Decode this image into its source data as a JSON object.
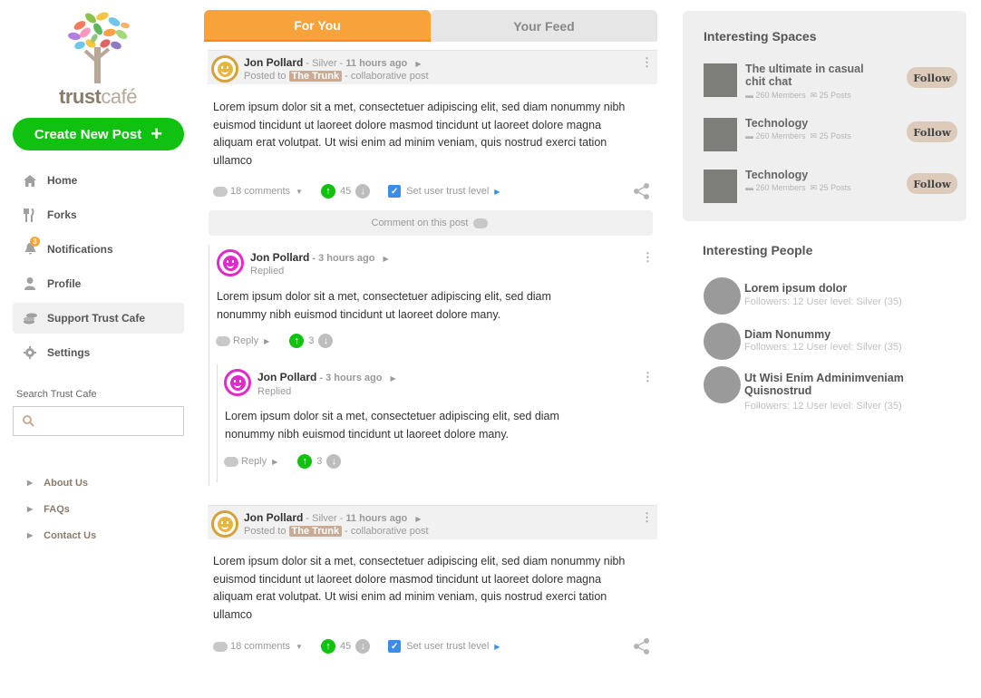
{
  "brand": {
    "name_main": "trust",
    "name_accent": "café"
  },
  "sidebar": {
    "create_button": "Create New Post",
    "nav": [
      {
        "label": "Home",
        "icon": "home-icon"
      },
      {
        "label": "Forks",
        "icon": "forks-icon"
      },
      {
        "label": "Notifications",
        "icon": "bell-icon",
        "badge": "3"
      },
      {
        "label": "Profile",
        "icon": "user-icon"
      },
      {
        "label": "Support Trust Cafe",
        "icon": "coins-icon"
      },
      {
        "label": "Settings",
        "icon": "gear-icon"
      }
    ],
    "search_label": "Search Trust Cafe",
    "search_placeholder": "",
    "footer_links": [
      "About Us",
      "FAQs",
      "Contact Us"
    ]
  },
  "tabs": {
    "for_you": "For You",
    "your_feed": "Your Feed"
  },
  "posts": [
    {
      "author": "Jon Pollard",
      "rank": "- Silver -",
      "time": "11 hours ago",
      "posted_to_prefix": "Posted to",
      "space_tag": "The Trunk",
      "posted_to_suffix": "- collaborative post",
      "body": "Lorem ipsum dolor sit a met, consectetuer adipiscing elit, sed diam nonummy nibh euismod tincidunt ut laoreet dolore masmod tincidunt ut laoreet dolore magna aliquam erat volutpat. Ut wisi enim ad minim veniam, quis nostrud exerci tation ullamco",
      "comments": "18 comments",
      "votes": "45",
      "trust_label": "Set user trust level"
    },
    {
      "author": "Jon Pollard",
      "rank": "- Silver -",
      "time": "11 hours ago",
      "posted_to_prefix": "Posted to",
      "space_tag": "The Trunk",
      "posted_to_suffix": "- collaborative post",
      "body": "Lorem ipsum dolor sit a met, consectetuer adipiscing elit, sed diam nonummy nibh euismod tincidunt ut laoreet dolore masmod tincidunt ut laoreet dolore magna aliquam erat volutpat. Ut wisi enim ad minim veniam, quis nostrud exerci tation ullamco",
      "comments": "18 comments",
      "votes": "45",
      "trust_label": "Set user trust level"
    }
  ],
  "comment_bar": "Comment on this post",
  "replies": [
    {
      "author": "Jon Pollard",
      "time": "- 3 hours ago",
      "status": "Replied",
      "body": "Lorem ipsum dolor sit a met, consectetuer adipiscing elit, sed diam nonummy nibh euismod tincidunt ut laoreet dolore many.",
      "reply_label": "Reply",
      "votes": "3"
    },
    {
      "author": "Jon Pollard",
      "time": "- 3 hours ago",
      "status": "Replied",
      "body": "Lorem ipsum dolor sit a met, consectetuer adipiscing elit, sed diam nonummy nibh euismod tincidunt ut laoreet dolore many.",
      "reply_label": "Reply",
      "votes": "3"
    }
  ],
  "spaces": {
    "title": "Interesting Spaces",
    "items": [
      {
        "name": "The ultimate in casual chit chat",
        "members": "260 Members",
        "posts": "25 Posts",
        "button": "Follow"
      },
      {
        "name": "Technology",
        "members": "260 Members",
        "posts": "25 Posts",
        "button": "Follow"
      },
      {
        "name": "Technology",
        "members": "260 Members",
        "posts": "25 Posts",
        "button": "Follow"
      }
    ]
  },
  "people": {
    "title": "Interesting  People",
    "items": [
      {
        "name": "Lorem ipsum dolor",
        "meta": "Followers: 12 User level: Silver (35)"
      },
      {
        "name": "Diam Nonummy",
        "meta": "Followers: 12 User level: Silver (35)"
      },
      {
        "name": "Ut Wisi Enim Adminimveniam Quisnostrud",
        "meta": "Followers: 12 User level: Silver (35)"
      }
    ]
  },
  "colors": {
    "accent_orange": "#f7a23a",
    "create_green": "#10c20f",
    "tag_tan": "#c9ab94",
    "follow_tan": "#dccbbb"
  }
}
